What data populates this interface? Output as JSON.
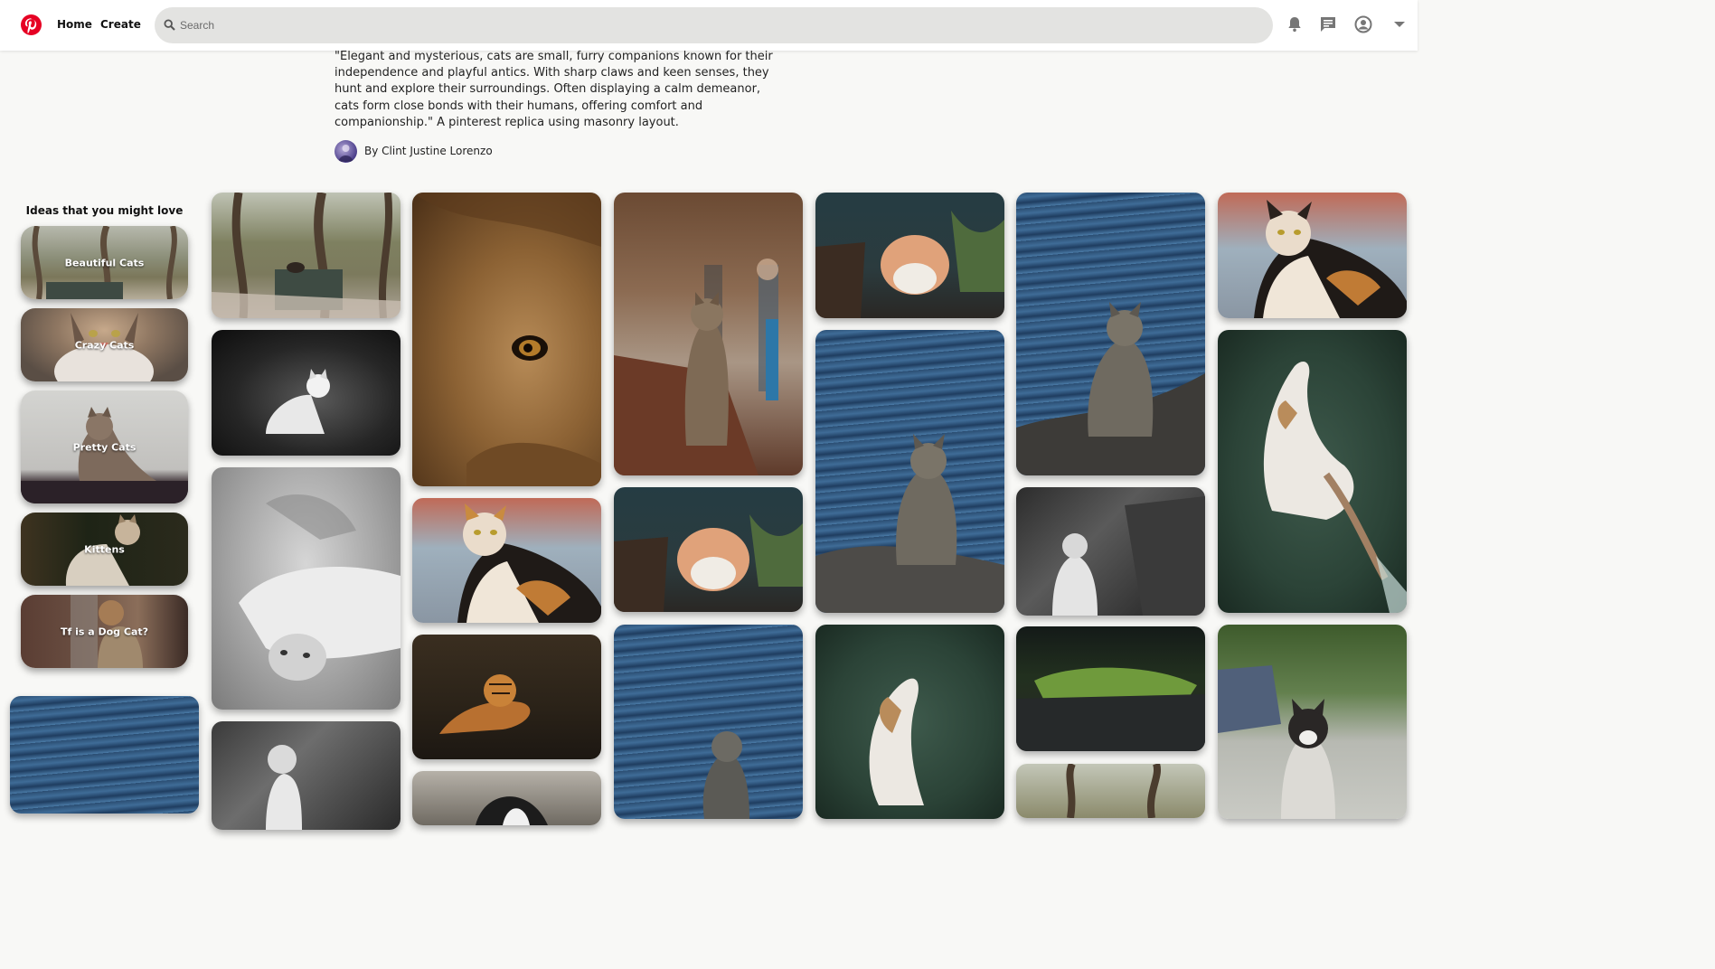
{
  "header": {
    "nav": {
      "home": "Home",
      "create": "Create"
    },
    "search": {
      "placeholder": "Search"
    },
    "icons": [
      "pinterest-logo",
      "bell-icon",
      "chat-icon",
      "account-icon",
      "chevron-down-icon"
    ],
    "accent": "#e60023"
  },
  "board": {
    "description": "\"Elegant and mysterious, cats are small, furry companions known for their independence and playful antics. With sharp claws and keen senses, they hunt and explore their surroundings. Often displaying a calm demeanor, cats form close bonds with their humans, offering comfort and companionship.\" A pinterest replica using masonry layout.",
    "author": "By Clint Justine Lorenzo"
  },
  "ideas": {
    "title": "Ideas that you might love",
    "items": [
      {
        "label": "Beautiful Cats"
      },
      {
        "label": "Crazy Cats"
      },
      {
        "label": "Pretty Cats"
      },
      {
        "label": "Kittens"
      },
      {
        "label": "Tf is a Dog Cat?"
      }
    ]
  }
}
